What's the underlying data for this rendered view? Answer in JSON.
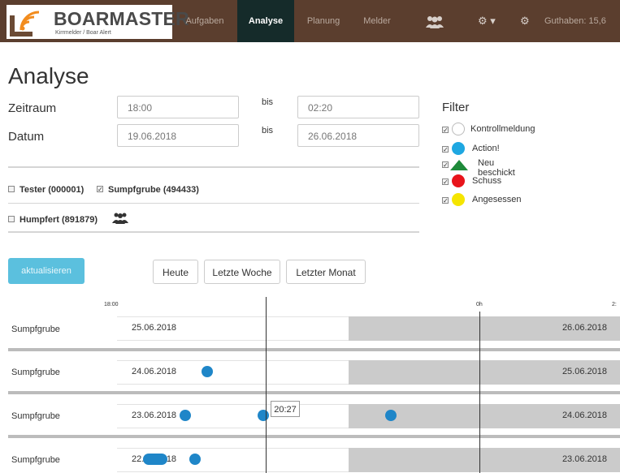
{
  "nav": {
    "logo_title": "BOARMASTER",
    "logo_sub": "Kirrmelder / Boar Alert",
    "items": [
      "Aufgaben",
      "Analyse",
      "Planung",
      "Melder"
    ],
    "active": "Analyse",
    "balance": "Guthaben: 15,6"
  },
  "page": {
    "title": "Analyse"
  },
  "form": {
    "zeitraum_label": "Zeitraum",
    "datum_label": "Datum",
    "bis": "bis",
    "time_from": "18:00",
    "time_to": "02:20",
    "date_from": "19.06.2018",
    "date_to": "26.06.2018"
  },
  "devices": [
    {
      "label": "Tester (000001)",
      "checked": false
    },
    {
      "label": "Sumpfgrube (494433)",
      "checked": true
    },
    {
      "label": "Humpfert (891879)",
      "checked": false
    }
  ],
  "filter": {
    "title": "Filter",
    "items": [
      {
        "label": "Kontrollmeldung",
        "checked": true,
        "color": "#ffffff",
        "shape": "circle"
      },
      {
        "label": "Action!",
        "checked": true,
        "color": "#1ea7e1",
        "shape": "circle"
      },
      {
        "label": "Neu beschickt",
        "checked": true,
        "color": "#1e8a3a",
        "shape": "triangle"
      },
      {
        "label": "Schuss",
        "checked": true,
        "color": "#e8141b",
        "shape": "circle"
      },
      {
        "label": "Angesessen",
        "checked": true,
        "color": "#f5e500",
        "shape": "circle"
      }
    ]
  },
  "buttons": {
    "refresh": "aktualisieren",
    "today": "Heute",
    "last_week": "Letzte Woche",
    "last_month": "Letzter Monat"
  },
  "timeline": {
    "tick_start": "18:00",
    "tick_mid": "0h",
    "tick_end": "2:",
    "tooltip": "20:27",
    "rows": [
      {
        "label": "Sumpfgrube",
        "left_date": "25.06.2018",
        "right_date": "26.06.2018"
      },
      {
        "label": "Sumpfgrube",
        "left_date": "24.06.2018",
        "right_date": "25.06.2018"
      },
      {
        "label": "Sumpfgrube",
        "left_date": "23.06.2018",
        "right_date": "24.06.2018"
      },
      {
        "label": "Sumpfgrube",
        "left_date": "22.06.2018",
        "right_date": "23.06.2018"
      }
    ]
  }
}
